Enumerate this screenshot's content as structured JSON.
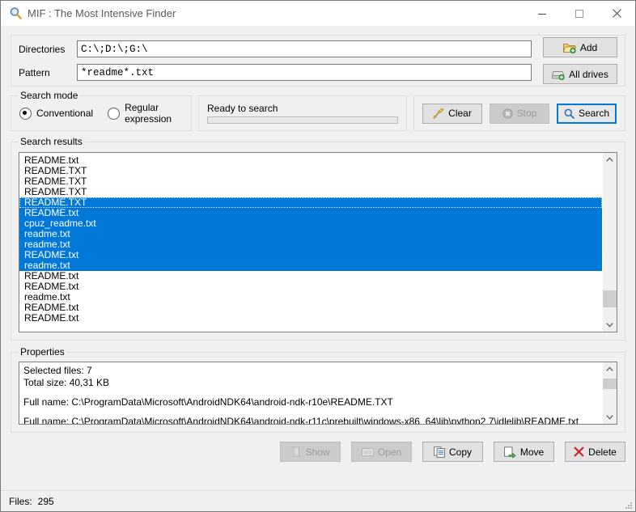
{
  "window": {
    "title": "MIF : The Most Intensive Finder",
    "icon": "magnifier-icon",
    "minimize_label": "Minimize",
    "maximize_label": "Maximize",
    "close_label": "Close"
  },
  "search_form": {
    "directories_label": "Directories",
    "directories_value": "C:\\;D:\\;G:\\",
    "directories_placeholder": "",
    "pattern_label": "Pattern",
    "pattern_value": "*readme*.txt",
    "pattern_placeholder": "",
    "add_label": "Add",
    "all_drives_label": "All drives"
  },
  "search_mode": {
    "group_title": "Search mode",
    "options": [
      {
        "label": "Conventional",
        "selected": true
      },
      {
        "label": "Regular expression",
        "selected": false
      }
    ]
  },
  "progress": {
    "status_text": "Ready to search",
    "percent": 0
  },
  "actions": {
    "clear_label": "Clear",
    "stop_label": "Stop",
    "stop_enabled": false,
    "search_label": "Search",
    "search_is_default": true
  },
  "results": {
    "group_title": "Search results",
    "items": [
      {
        "name": "README.txt",
        "selected": false,
        "focused": false
      },
      {
        "name": "README.TXT",
        "selected": false,
        "focused": false
      },
      {
        "name": "README.TXT",
        "selected": false,
        "focused": false
      },
      {
        "name": "README.TXT",
        "selected": false,
        "focused": false
      },
      {
        "name": "README.TXT",
        "selected": true,
        "focused": true
      },
      {
        "name": "README.txt",
        "selected": true,
        "focused": false
      },
      {
        "name": "cpuz_readme.txt",
        "selected": true,
        "focused": false
      },
      {
        "name": "readme.txt",
        "selected": true,
        "focused": false
      },
      {
        "name": "readme.txt",
        "selected": true,
        "focused": false
      },
      {
        "name": "README.txt",
        "selected": true,
        "focused": false
      },
      {
        "name": "readme.txt",
        "selected": true,
        "focused": false
      },
      {
        "name": "README.txt",
        "selected": false,
        "focused": false
      },
      {
        "name": "README.txt",
        "selected": false,
        "focused": false
      },
      {
        "name": "readme.txt",
        "selected": false,
        "focused": false
      },
      {
        "name": "README.txt",
        "selected": false,
        "focused": false
      },
      {
        "name": "README.txt",
        "selected": false,
        "focused": false
      }
    ],
    "scrollbar": {
      "thumb_top_percent": 82,
      "thumb_height_percent": 11
    }
  },
  "properties": {
    "group_title": "Properties",
    "lines": [
      "Selected files: 7",
      "Total size: 40,31 KB",
      "",
      "Full name: C:\\ProgramData\\Microsoft\\AndroidNDK64\\android-ndk-r10e\\README.TXT",
      "",
      "Full name: C:\\ProgramData\\Microsoft\\AndroidNDK64\\android-ndk-r11c\\prebuilt\\windows-x86_64\\lib\\python2.7\\idlelib\\README.txt"
    ],
    "scrollbar": {
      "thumb_top_percent": 8,
      "thumb_height_percent": 30
    }
  },
  "file_actions": [
    {
      "label": "Show",
      "icon": "show-icon",
      "enabled": false
    },
    {
      "label": "Open",
      "icon": "open-icon",
      "enabled": false
    },
    {
      "label": "Copy",
      "icon": "copy-icon",
      "enabled": true
    },
    {
      "label": "Move",
      "icon": "move-icon",
      "enabled": true
    },
    {
      "label": "Delete",
      "icon": "delete-icon",
      "enabled": true
    }
  ],
  "statusbar": {
    "files_label": "Files:",
    "files_count": "295"
  },
  "colors": {
    "selection_blue": "#0078d7",
    "window_bg": "#f0f0f0",
    "title_text": "#5a5a5a",
    "accent": "#0078d7",
    "delete_red": "#cc2222"
  }
}
